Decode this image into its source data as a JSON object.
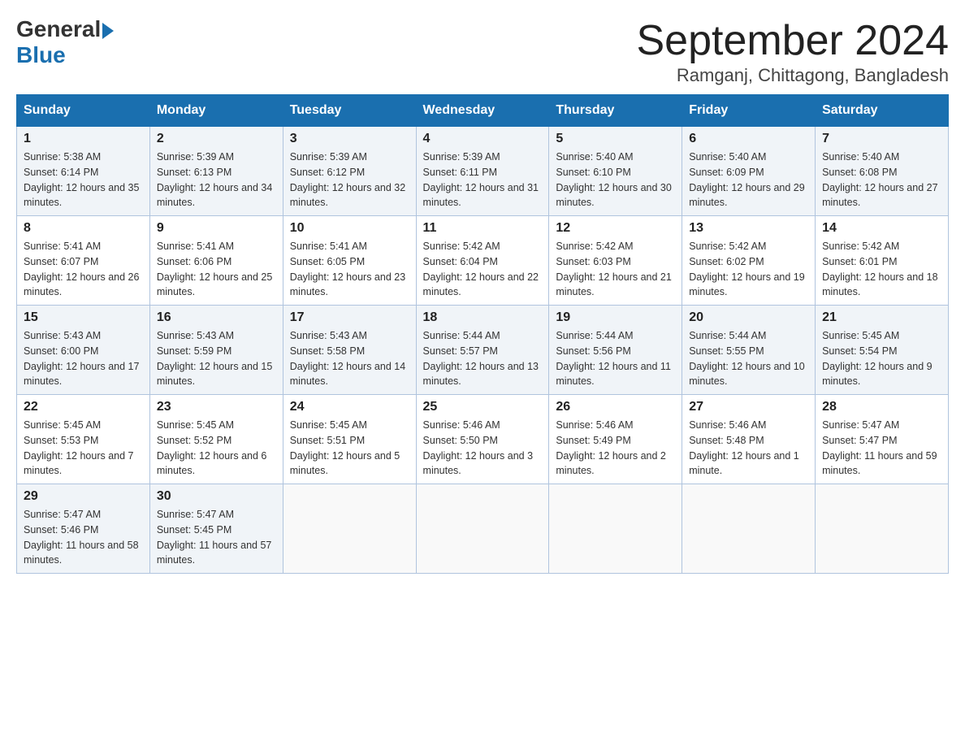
{
  "header": {
    "logo_general": "General",
    "logo_blue": "Blue",
    "month_title": "September 2024",
    "location": "Ramganj, Chittagong, Bangladesh"
  },
  "days_of_week": [
    "Sunday",
    "Monday",
    "Tuesday",
    "Wednesday",
    "Thursday",
    "Friday",
    "Saturday"
  ],
  "weeks": [
    [
      {
        "day": "1",
        "sunrise": "Sunrise: 5:38 AM",
        "sunset": "Sunset: 6:14 PM",
        "daylight": "Daylight: 12 hours and 35 minutes."
      },
      {
        "day": "2",
        "sunrise": "Sunrise: 5:39 AM",
        "sunset": "Sunset: 6:13 PM",
        "daylight": "Daylight: 12 hours and 34 minutes."
      },
      {
        "day": "3",
        "sunrise": "Sunrise: 5:39 AM",
        "sunset": "Sunset: 6:12 PM",
        "daylight": "Daylight: 12 hours and 32 minutes."
      },
      {
        "day": "4",
        "sunrise": "Sunrise: 5:39 AM",
        "sunset": "Sunset: 6:11 PM",
        "daylight": "Daylight: 12 hours and 31 minutes."
      },
      {
        "day": "5",
        "sunrise": "Sunrise: 5:40 AM",
        "sunset": "Sunset: 6:10 PM",
        "daylight": "Daylight: 12 hours and 30 minutes."
      },
      {
        "day": "6",
        "sunrise": "Sunrise: 5:40 AM",
        "sunset": "Sunset: 6:09 PM",
        "daylight": "Daylight: 12 hours and 29 minutes."
      },
      {
        "day": "7",
        "sunrise": "Sunrise: 5:40 AM",
        "sunset": "Sunset: 6:08 PM",
        "daylight": "Daylight: 12 hours and 27 minutes."
      }
    ],
    [
      {
        "day": "8",
        "sunrise": "Sunrise: 5:41 AM",
        "sunset": "Sunset: 6:07 PM",
        "daylight": "Daylight: 12 hours and 26 minutes."
      },
      {
        "day": "9",
        "sunrise": "Sunrise: 5:41 AM",
        "sunset": "Sunset: 6:06 PM",
        "daylight": "Daylight: 12 hours and 25 minutes."
      },
      {
        "day": "10",
        "sunrise": "Sunrise: 5:41 AM",
        "sunset": "Sunset: 6:05 PM",
        "daylight": "Daylight: 12 hours and 23 minutes."
      },
      {
        "day": "11",
        "sunrise": "Sunrise: 5:42 AM",
        "sunset": "Sunset: 6:04 PM",
        "daylight": "Daylight: 12 hours and 22 minutes."
      },
      {
        "day": "12",
        "sunrise": "Sunrise: 5:42 AM",
        "sunset": "Sunset: 6:03 PM",
        "daylight": "Daylight: 12 hours and 21 minutes."
      },
      {
        "day": "13",
        "sunrise": "Sunrise: 5:42 AM",
        "sunset": "Sunset: 6:02 PM",
        "daylight": "Daylight: 12 hours and 19 minutes."
      },
      {
        "day": "14",
        "sunrise": "Sunrise: 5:42 AM",
        "sunset": "Sunset: 6:01 PM",
        "daylight": "Daylight: 12 hours and 18 minutes."
      }
    ],
    [
      {
        "day": "15",
        "sunrise": "Sunrise: 5:43 AM",
        "sunset": "Sunset: 6:00 PM",
        "daylight": "Daylight: 12 hours and 17 minutes."
      },
      {
        "day": "16",
        "sunrise": "Sunrise: 5:43 AM",
        "sunset": "Sunset: 5:59 PM",
        "daylight": "Daylight: 12 hours and 15 minutes."
      },
      {
        "day": "17",
        "sunrise": "Sunrise: 5:43 AM",
        "sunset": "Sunset: 5:58 PM",
        "daylight": "Daylight: 12 hours and 14 minutes."
      },
      {
        "day": "18",
        "sunrise": "Sunrise: 5:44 AM",
        "sunset": "Sunset: 5:57 PM",
        "daylight": "Daylight: 12 hours and 13 minutes."
      },
      {
        "day": "19",
        "sunrise": "Sunrise: 5:44 AM",
        "sunset": "Sunset: 5:56 PM",
        "daylight": "Daylight: 12 hours and 11 minutes."
      },
      {
        "day": "20",
        "sunrise": "Sunrise: 5:44 AM",
        "sunset": "Sunset: 5:55 PM",
        "daylight": "Daylight: 12 hours and 10 minutes."
      },
      {
        "day": "21",
        "sunrise": "Sunrise: 5:45 AM",
        "sunset": "Sunset: 5:54 PM",
        "daylight": "Daylight: 12 hours and 9 minutes."
      }
    ],
    [
      {
        "day": "22",
        "sunrise": "Sunrise: 5:45 AM",
        "sunset": "Sunset: 5:53 PM",
        "daylight": "Daylight: 12 hours and 7 minutes."
      },
      {
        "day": "23",
        "sunrise": "Sunrise: 5:45 AM",
        "sunset": "Sunset: 5:52 PM",
        "daylight": "Daylight: 12 hours and 6 minutes."
      },
      {
        "day": "24",
        "sunrise": "Sunrise: 5:45 AM",
        "sunset": "Sunset: 5:51 PM",
        "daylight": "Daylight: 12 hours and 5 minutes."
      },
      {
        "day": "25",
        "sunrise": "Sunrise: 5:46 AM",
        "sunset": "Sunset: 5:50 PM",
        "daylight": "Daylight: 12 hours and 3 minutes."
      },
      {
        "day": "26",
        "sunrise": "Sunrise: 5:46 AM",
        "sunset": "Sunset: 5:49 PM",
        "daylight": "Daylight: 12 hours and 2 minutes."
      },
      {
        "day": "27",
        "sunrise": "Sunrise: 5:46 AM",
        "sunset": "Sunset: 5:48 PM",
        "daylight": "Daylight: 12 hours and 1 minute."
      },
      {
        "day": "28",
        "sunrise": "Sunrise: 5:47 AM",
        "sunset": "Sunset: 5:47 PM",
        "daylight": "Daylight: 11 hours and 59 minutes."
      }
    ],
    [
      {
        "day": "29",
        "sunrise": "Sunrise: 5:47 AM",
        "sunset": "Sunset: 5:46 PM",
        "daylight": "Daylight: 11 hours and 58 minutes."
      },
      {
        "day": "30",
        "sunrise": "Sunrise: 5:47 AM",
        "sunset": "Sunset: 5:45 PM",
        "daylight": "Daylight: 11 hours and 57 minutes."
      },
      null,
      null,
      null,
      null,
      null
    ]
  ]
}
